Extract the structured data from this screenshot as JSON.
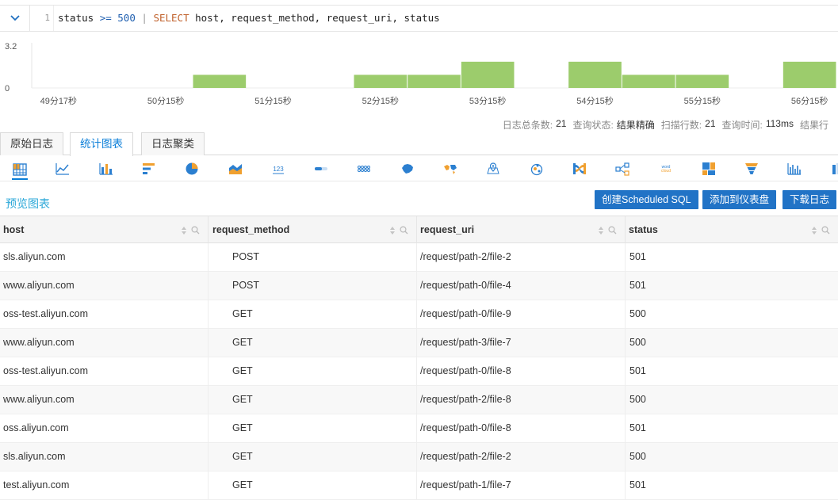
{
  "query": {
    "line_number": "1",
    "tokens": [
      {
        "text": "status",
        "kind": "field"
      },
      {
        "text": " ",
        "kind": "field"
      },
      {
        "text": ">=",
        "kind": "op"
      },
      {
        "text": " ",
        "kind": "field"
      },
      {
        "text": "500",
        "kind": "num"
      },
      {
        "text": " ",
        "kind": "field"
      },
      {
        "text": "|",
        "kind": "pipe"
      },
      {
        "text": " ",
        "kind": "field"
      },
      {
        "text": "SELECT",
        "kind": "kw"
      },
      {
        "text": " host, request_method, request_uri, status",
        "kind": "field"
      }
    ]
  },
  "chart_data": {
    "type": "bar",
    "title": "",
    "xlabel": "",
    "ylabel": "",
    "ylim": [
      0,
      3.2
    ],
    "y_ticks": [
      "3.2",
      "0"
    ],
    "x_ticks": [
      "49分17秒",
      "50分15秒",
      "51分15秒",
      "52分15秒",
      "53分15秒",
      "54分15秒",
      "55分15秒",
      "56分15秒"
    ],
    "bar_color": "#9ccc6c",
    "bin_count": 15,
    "bars": [
      {
        "bin": 3,
        "value": 1
      },
      {
        "bin": 6,
        "value": 1
      },
      {
        "bin": 7,
        "value": 1
      },
      {
        "bin": 8,
        "value": 2
      },
      {
        "bin": 10,
        "value": 2
      },
      {
        "bin": 11,
        "value": 1
      },
      {
        "bin": 12,
        "value": 1
      },
      {
        "bin": 14,
        "value": 2
      }
    ]
  },
  "stats": [
    {
      "label": "日志总条数:",
      "value": "21"
    },
    {
      "label": "查询状态:",
      "value": "结果精确"
    },
    {
      "label": "扫描行数:",
      "value": "21"
    },
    {
      "label": "查询时间:",
      "value": "113ms"
    },
    {
      "label": "结果行",
      "value": ""
    }
  ],
  "tabs": [
    {
      "label": "原始日志",
      "active": false
    },
    {
      "label": "统计图表",
      "active": true
    },
    {
      "label": "日志聚类",
      "active": false
    }
  ],
  "chart_types": [
    "table-icon",
    "line-chart-icon",
    "bar-chart-icon",
    "horizontal-bar-icon",
    "pie-chart-icon",
    "area-chart-icon",
    "single-value-icon",
    "progress-bar-icon",
    "dot-grid-icon",
    "china-map-icon",
    "world-map-icon",
    "location-pin-icon",
    "scatter-map-icon",
    "sankey-icon",
    "flow-graph-icon",
    "word-cloud-icon",
    "treemap-icon",
    "funnel-icon",
    "histogram-icon",
    "column-compare-icon"
  ],
  "preview": {
    "title": "预览图表",
    "create_sql_label": "创建Scheduled SQL",
    "add_dashboard_label": "添加到仪表盘",
    "download_label": "下载日志"
  },
  "table": {
    "columns": [
      "host",
      "request_method",
      "request_uri",
      "status"
    ],
    "rows": [
      [
        "sls.aliyun.com",
        "POST",
        "/request/path-2/file-2",
        "501"
      ],
      [
        "www.aliyun.com",
        "POST",
        "/request/path-0/file-4",
        "501"
      ],
      [
        "oss-test.aliyun.com",
        "GET",
        "/request/path-0/file-9",
        "500"
      ],
      [
        "www.aliyun.com",
        "GET",
        "/request/path-3/file-7",
        "500"
      ],
      [
        "oss-test.aliyun.com",
        "GET",
        "/request/path-0/file-8",
        "501"
      ],
      [
        "www.aliyun.com",
        "GET",
        "/request/path-2/file-8",
        "500"
      ],
      [
        "oss.aliyun.com",
        "GET",
        "/request/path-0/file-8",
        "501"
      ],
      [
        "sls.aliyun.com",
        "GET",
        "/request/path-2/file-2",
        "500"
      ],
      [
        "test.aliyun.com",
        "GET",
        "/request/path-1/file-7",
        "501"
      ]
    ]
  }
}
